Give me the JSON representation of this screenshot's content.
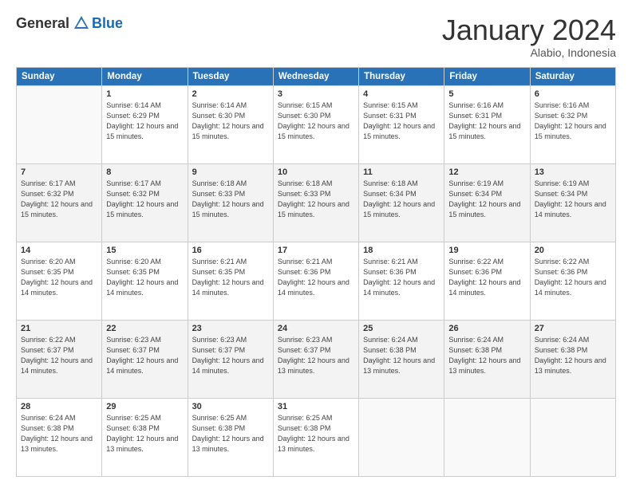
{
  "header": {
    "logo_general": "General",
    "logo_blue": "Blue",
    "month_title": "January 2024",
    "subtitle": "Alabio, Indonesia"
  },
  "days_of_week": [
    "Sunday",
    "Monday",
    "Tuesday",
    "Wednesday",
    "Thursday",
    "Friday",
    "Saturday"
  ],
  "weeks": [
    [
      {
        "day": "",
        "empty": true
      },
      {
        "day": "1",
        "rise": "6:14 AM",
        "set": "6:29 PM",
        "daylight": "12 hours and 15 minutes."
      },
      {
        "day": "2",
        "rise": "6:14 AM",
        "set": "6:30 PM",
        "daylight": "12 hours and 15 minutes."
      },
      {
        "day": "3",
        "rise": "6:15 AM",
        "set": "6:30 PM",
        "daylight": "12 hours and 15 minutes."
      },
      {
        "day": "4",
        "rise": "6:15 AM",
        "set": "6:31 PM",
        "daylight": "12 hours and 15 minutes."
      },
      {
        "day": "5",
        "rise": "6:16 AM",
        "set": "6:31 PM",
        "daylight": "12 hours and 15 minutes."
      },
      {
        "day": "6",
        "rise": "6:16 AM",
        "set": "6:32 PM",
        "daylight": "12 hours and 15 minutes."
      }
    ],
    [
      {
        "day": "7",
        "rise": "6:17 AM",
        "set": "6:32 PM",
        "daylight": "12 hours and 15 minutes."
      },
      {
        "day": "8",
        "rise": "6:17 AM",
        "set": "6:32 PM",
        "daylight": "12 hours and 15 minutes."
      },
      {
        "day": "9",
        "rise": "6:18 AM",
        "set": "6:33 PM",
        "daylight": "12 hours and 15 minutes."
      },
      {
        "day": "10",
        "rise": "6:18 AM",
        "set": "6:33 PM",
        "daylight": "12 hours and 15 minutes."
      },
      {
        "day": "11",
        "rise": "6:18 AM",
        "set": "6:34 PM",
        "daylight": "12 hours and 15 minutes."
      },
      {
        "day": "12",
        "rise": "6:19 AM",
        "set": "6:34 PM",
        "daylight": "12 hours and 15 minutes."
      },
      {
        "day": "13",
        "rise": "6:19 AM",
        "set": "6:34 PM",
        "daylight": "12 hours and 14 minutes."
      }
    ],
    [
      {
        "day": "14",
        "rise": "6:20 AM",
        "set": "6:35 PM",
        "daylight": "12 hours and 14 minutes."
      },
      {
        "day": "15",
        "rise": "6:20 AM",
        "set": "6:35 PM",
        "daylight": "12 hours and 14 minutes."
      },
      {
        "day": "16",
        "rise": "6:21 AM",
        "set": "6:35 PM",
        "daylight": "12 hours and 14 minutes."
      },
      {
        "day": "17",
        "rise": "6:21 AM",
        "set": "6:36 PM",
        "daylight": "12 hours and 14 minutes."
      },
      {
        "day": "18",
        "rise": "6:21 AM",
        "set": "6:36 PM",
        "daylight": "12 hours and 14 minutes."
      },
      {
        "day": "19",
        "rise": "6:22 AM",
        "set": "6:36 PM",
        "daylight": "12 hours and 14 minutes."
      },
      {
        "day": "20",
        "rise": "6:22 AM",
        "set": "6:36 PM",
        "daylight": "12 hours and 14 minutes."
      }
    ],
    [
      {
        "day": "21",
        "rise": "6:22 AM",
        "set": "6:37 PM",
        "daylight": "12 hours and 14 minutes."
      },
      {
        "day": "22",
        "rise": "6:23 AM",
        "set": "6:37 PM",
        "daylight": "12 hours and 14 minutes."
      },
      {
        "day": "23",
        "rise": "6:23 AM",
        "set": "6:37 PM",
        "daylight": "12 hours and 14 minutes."
      },
      {
        "day": "24",
        "rise": "6:23 AM",
        "set": "6:37 PM",
        "daylight": "12 hours and 13 minutes."
      },
      {
        "day": "25",
        "rise": "6:24 AM",
        "set": "6:38 PM",
        "daylight": "12 hours and 13 minutes."
      },
      {
        "day": "26",
        "rise": "6:24 AM",
        "set": "6:38 PM",
        "daylight": "12 hours and 13 minutes."
      },
      {
        "day": "27",
        "rise": "6:24 AM",
        "set": "6:38 PM",
        "daylight": "12 hours and 13 minutes."
      }
    ],
    [
      {
        "day": "28",
        "rise": "6:24 AM",
        "set": "6:38 PM",
        "daylight": "12 hours and 13 minutes."
      },
      {
        "day": "29",
        "rise": "6:25 AM",
        "set": "6:38 PM",
        "daylight": "12 hours and 13 minutes."
      },
      {
        "day": "30",
        "rise": "6:25 AM",
        "set": "6:38 PM",
        "daylight": "12 hours and 13 minutes."
      },
      {
        "day": "31",
        "rise": "6:25 AM",
        "set": "6:38 PM",
        "daylight": "12 hours and 13 minutes."
      },
      {
        "day": "",
        "empty": true
      },
      {
        "day": "",
        "empty": true
      },
      {
        "day": "",
        "empty": true
      }
    ]
  ]
}
